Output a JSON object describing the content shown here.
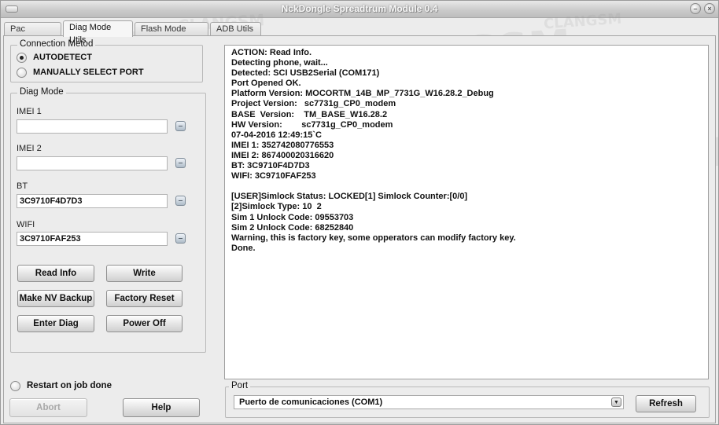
{
  "window": {
    "title": "NckDongle Spreadtrum Module 0.4"
  },
  "tabs": [
    {
      "label": "Pac Flasher",
      "active": false
    },
    {
      "label": "Diag Mode Utils",
      "active": true
    },
    {
      "label": "Flash Mode Utils",
      "active": false
    },
    {
      "label": "ADB Utils",
      "active": false
    }
  ],
  "connection": {
    "group_label": "Connection Metod",
    "options": [
      {
        "label": "AUTODETECT",
        "selected": true
      },
      {
        "label": "MANUALLY SELECT PORT",
        "selected": false
      }
    ]
  },
  "diag": {
    "group_label": "Diag Mode",
    "fields": [
      {
        "label": "IMEI 1",
        "value": ""
      },
      {
        "label": "IMEI 2",
        "value": ""
      },
      {
        "label": "BT",
        "value": "3C9710F4D7D3"
      },
      {
        "label": "WIFI",
        "value": "3C9710FAF253"
      }
    ],
    "buttons": {
      "read_info": "Read Info",
      "write": "Write",
      "make_nv_backup": "Make NV Backup",
      "factory_reset": "Factory Reset",
      "enter_diag": "Enter Diag",
      "power_off": "Power Off"
    }
  },
  "footer": {
    "restart_label": "Restart on job done",
    "restart_checked": false,
    "abort_label": "Abort",
    "help_label": "Help"
  },
  "log": {
    "lines": [
      "ACTION: Read Info.",
      "Detecting phone, wait...",
      "Detected: SCI USB2Serial (COM171)",
      "Port Opened OK.",
      "Platform Version: MOCORTM_14B_MP_7731G_W16.28.2_Debug",
      "Project Version:   sc7731g_CP0_modem",
      "BASE  Version:    TM_BASE_W16.28.2",
      "HW Version:        sc7731g_CP0_modem",
      "07-04-2016 12:49:15`C",
      "IMEI 1: 352742080776553",
      "IMEI 2: 867400020316620",
      "BT: 3C9710F4D7D3",
      "WIFI: 3C9710FAF253",
      "",
      "[USER]Simlock Status: LOCKED[1] Simlock Counter:[0/0]",
      "[2]Simlock Type: 10  2",
      "Sim 1 Unlock Code: 09553703",
      "Sim 2 Unlock Code: 68252840",
      "Warning, this is factory key, some opperators can modify factory key.",
      "Done."
    ]
  },
  "port": {
    "group_label": "Port",
    "selected": "Puerto de comunicaciones (COM1)",
    "refresh_label": "Refresh"
  },
  "watermark": {
    "big": "ClanGSM",
    "caps": "CLANGSM",
    "dotcom": "CLANGSM.COM",
    "small": "CLANGSM"
  }
}
